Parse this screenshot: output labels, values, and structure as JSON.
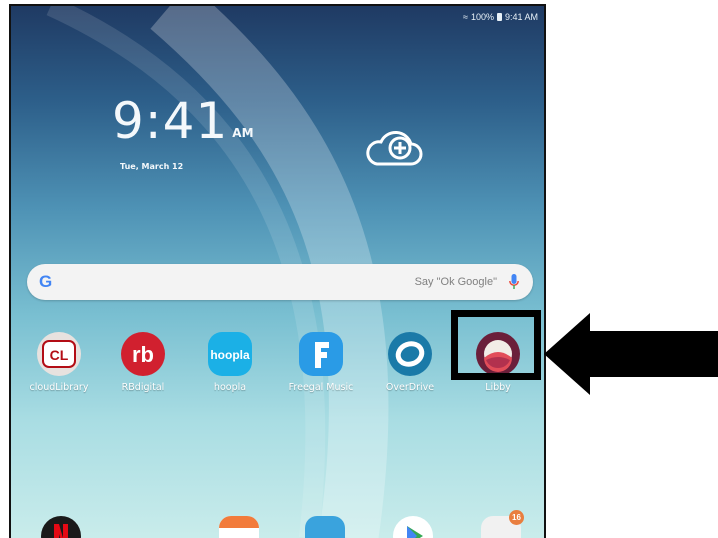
{
  "statusbar": {
    "battery": "100%",
    "time": "9:41 AM"
  },
  "clock": {
    "time": "9:41",
    "ampm": "AM",
    "date": "Tue, March 12"
  },
  "search": {
    "logo": "G",
    "hint": "Say \"Ok Google\""
  },
  "apps": [
    {
      "label": "cloudLibrary",
      "icon": "cloudlibrary-icon"
    },
    {
      "label": "RBdigital",
      "icon": "rbdigital-icon"
    },
    {
      "label": "hoopla",
      "icon": "hoopla-icon"
    },
    {
      "label": "Freegal Music",
      "icon": "freegal-icon"
    },
    {
      "label": "OverDrive",
      "icon": "overdrive-icon"
    },
    {
      "label": "Libby",
      "icon": "libby-icon"
    }
  ],
  "dock_badge": "16",
  "colors": {
    "highlight": "#000000",
    "arrow": "#000000"
  }
}
